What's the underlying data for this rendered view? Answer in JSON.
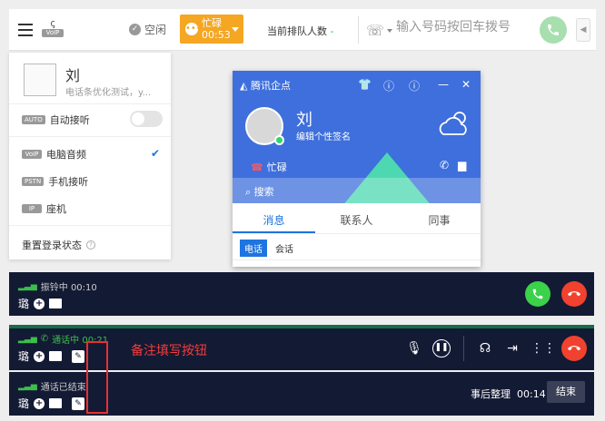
{
  "topbar": {
    "voip_tag": "VoIP",
    "status_idle": "空闲",
    "busy_label": "忙碌",
    "busy_time": "00:53",
    "queue_label": "当前排队人数",
    "queue_count": "-",
    "dial_placeholder": "输入号码按回车拨号"
  },
  "left_panel": {
    "user_name": "刘",
    "user_sub": "电话条优化测试，y...",
    "auto_tag": "AUTO",
    "auto_label": "自动接听",
    "voip_tag": "VoIP",
    "voip_label": "电脑音频",
    "pstn_tag": "PSTN",
    "pstn_label": "手机接听",
    "ip_tag": "IP",
    "ip_label": "座机",
    "reset_label": "重置登录状态",
    "question_mark": "?"
  },
  "qq_popup": {
    "app_name": "腾讯企点",
    "user_name": "刘",
    "signature": "编辑个性签名",
    "status": "忙碌",
    "search": "搜索",
    "tabs": [
      "消息",
      "联系人",
      "同事"
    ],
    "sub_tabs": [
      "电话",
      "会话"
    ]
  },
  "call_bars": [
    {
      "status": "振铃中 00:10",
      "name": "璐"
    },
    {
      "status": "通话中 00:21",
      "name": "璐"
    },
    {
      "status": "通话已结束",
      "name": "璐",
      "wrap_label": "事后整理",
      "wrap_time": "00:14",
      "end_label": "结束"
    }
  ],
  "annotation": "备注填写按钮",
  "colors": {
    "accent": "#f5a623",
    "call_green": "#3bd14a",
    "hangup_red": "#f0422e",
    "bar_bg": "#131a34",
    "qq_blue": "#3e6fdc"
  }
}
